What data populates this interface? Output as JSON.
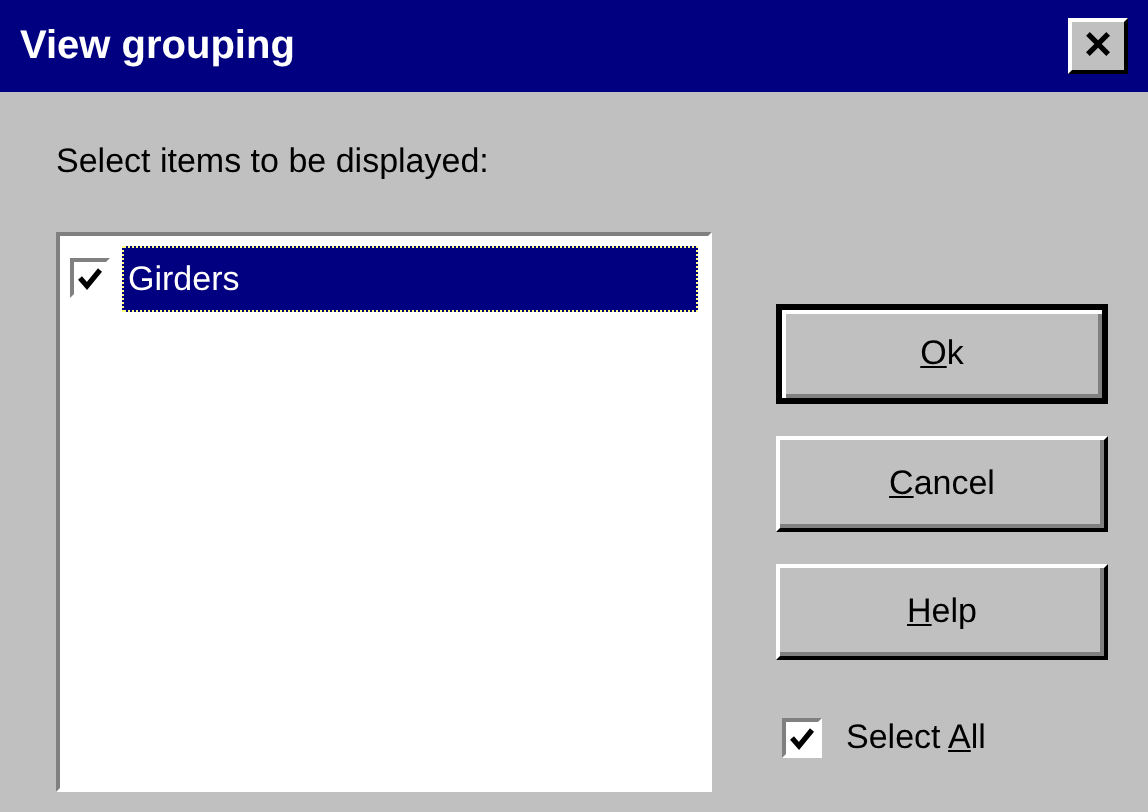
{
  "window": {
    "title": "View grouping",
    "close": "×"
  },
  "prompt": "Select items to be displayed:",
  "items": [
    {
      "label": "Girders",
      "checked": true,
      "selected": true
    }
  ],
  "buttons": [
    {
      "mnemonic": "O",
      "after": "k",
      "default": true
    },
    {
      "mnemonic": "C",
      "after": "ancel",
      "default": false
    },
    {
      "mnemonic": "H",
      "after": "elp",
      "default": false
    }
  ],
  "select_all": {
    "before": "Select ",
    "mnemonic": "A",
    "after": "ll",
    "checked": true
  }
}
